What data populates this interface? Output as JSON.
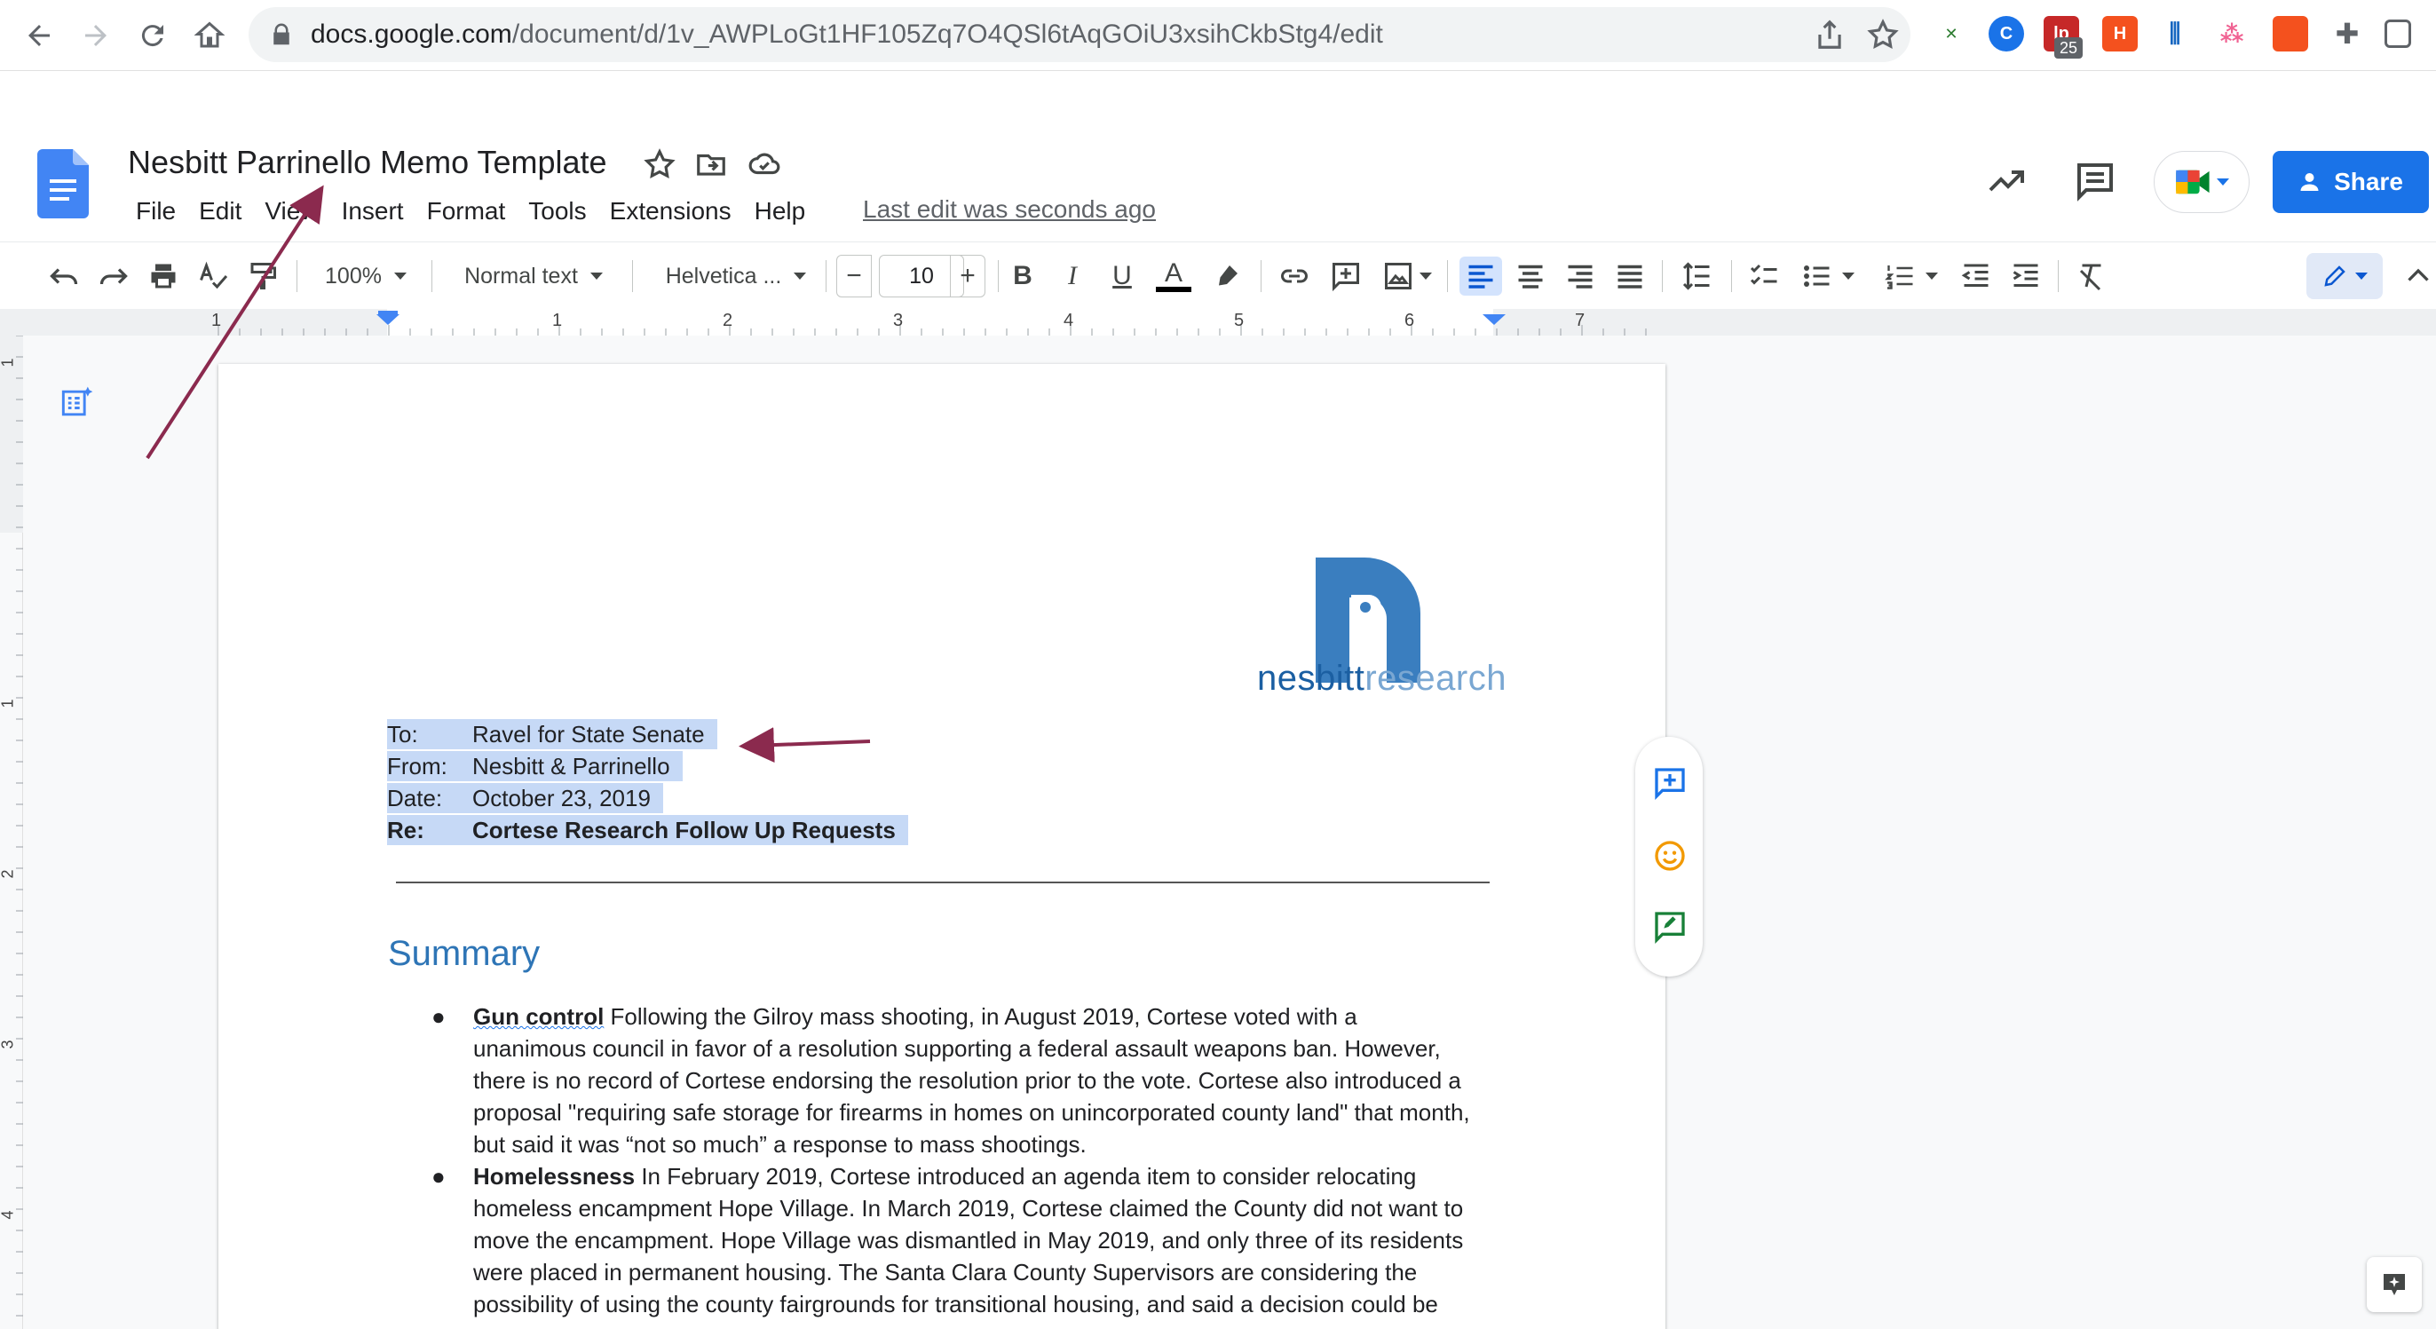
{
  "browser": {
    "url_host": "docs.google.com",
    "url_path": "/document/d/1v_AWPLoGt1HF105Zq7O4QSl6tAqGOiU3xsihCkbStg4/edit",
    "extension_badge": "25"
  },
  "docs": {
    "title": "Nesbitt Parrinello Memo Template",
    "menu": [
      "File",
      "Edit",
      "View",
      "Insert",
      "Format",
      "Tools",
      "Extensions",
      "Help"
    ],
    "last_edit": "Last edit was seconds ago",
    "share_label": "Share",
    "accent_color": "#1a73e8"
  },
  "toolbar": {
    "zoom": "100%",
    "style": "Normal text",
    "font": "Helvetica ...",
    "font_size": "10",
    "minus": "−",
    "plus": "+"
  },
  "ruler": {
    "h_numbers": [
      "1",
      "1",
      "2",
      "3",
      "4",
      "5",
      "6",
      "7"
    ],
    "v_numbers": [
      "1",
      "1",
      "2",
      "3",
      "4"
    ]
  },
  "document": {
    "logo_word_a": "nesbitt",
    "logo_word_b": "research",
    "logo_color": "#3a7ebf",
    "memo": [
      {
        "label": "To:",
        "value": "Ravel for State Senate"
      },
      {
        "label": "From:",
        "value": "Nesbitt & Parrinello"
      },
      {
        "label": "Date:",
        "value": "October 23, 2019"
      },
      {
        "label": "Re:",
        "value": "Cortese Research Follow Up Requests"
      }
    ],
    "heading": "Summary",
    "heading_color": "#2e75b6",
    "bullet_char": "●",
    "bullets": [
      {
        "title": "Gun control",
        "first_line_rest": " Following the Gilroy mass shooting, in August 2019, Cortese voted with a",
        "lines": [
          "unanimous council in favor of a resolution supporting a federal assault weapons ban. However,",
          "there is no record of Cortese endorsing the resolution prior to the vote. Cortese also introduced a",
          "proposal \"requiring safe storage for firearms in homes on unincorporated county land\" that month,",
          "but said it was “not so much” a response to mass shootings."
        ]
      },
      {
        "title": "Homelessness",
        "first_line_rest": " In February 2019, Cortese introduced an agenda item to consider relocating",
        "lines": [
          "homeless encampment Hope Village. In March 2019, Cortese claimed the County did not want to",
          "move the encampment. Hope Village was dismantled in May 2019, and only three of its residents",
          "were placed in permanent housing. The Santa Clara County Supervisors are considering the",
          "possibility of using the county fairgrounds for transitional housing, and said a decision could be"
        ]
      }
    ]
  },
  "annotations": {
    "arrow_color": "#8b2a4e"
  }
}
